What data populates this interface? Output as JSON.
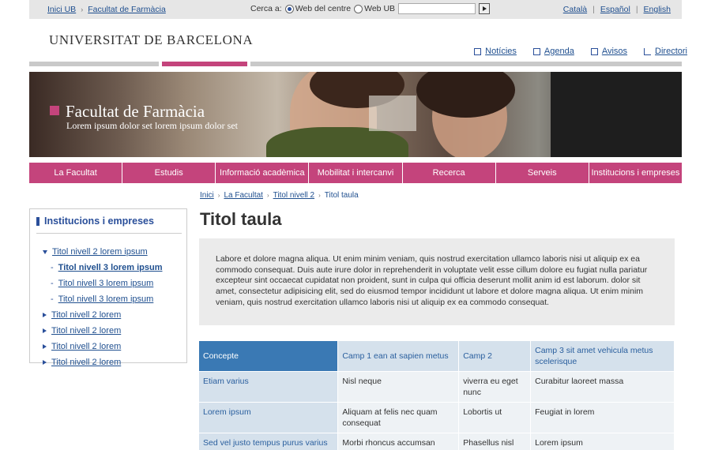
{
  "topbar": {
    "crumbs": [
      "Inici UB",
      "Facultat de Farmàcia"
    ],
    "search_label": "Cerca a:",
    "scope_options": [
      "Web del centre",
      "Web UB"
    ],
    "scope_selected": "Web del centre",
    "search_value": "",
    "languages": [
      "Català",
      "Español",
      "English"
    ]
  },
  "header": {
    "university": "UNIVERSITAT DE BARCELONA",
    "quicklinks": [
      {
        "label": "Notícies",
        "icon": "news-icon"
      },
      {
        "label": "Agenda",
        "icon": "calendar-icon"
      },
      {
        "label": "Avisos",
        "icon": "notice-icon"
      },
      {
        "label": "Directori",
        "icon": "directory-icon"
      }
    ]
  },
  "banner": {
    "title": "Facultat de Farmàcia",
    "subtitle": "Lorem ipsum dolor set lorem ipsum dolor set"
  },
  "mainnav": [
    "La Facultat",
    "Estudis",
    "Informació acadèmica",
    "Mobilitat i intercanvi",
    "Recerca",
    "Serveis",
    "Institucions i empreses"
  ],
  "breadcrumb": [
    "Inici",
    "La Facultat",
    "Titol nivell 2",
    "Titol taula"
  ],
  "sidebar": {
    "heading": "Institucions i empreses",
    "items": [
      {
        "label": "Titol nivell 2 lorem ipsum",
        "level": 2,
        "expanded": true
      },
      {
        "label": "Titol nivell 3 lorem ipsum",
        "level": 3,
        "active": true
      },
      {
        "label": "Titol nivell 3 lorem ipsum",
        "level": 3
      },
      {
        "label": "Titol nivell 3 lorem ipsum",
        "level": 3
      },
      {
        "label": "Titol nivell 2 lorem",
        "level": 2
      },
      {
        "label": "Titol nivell 2 lorem",
        "level": 2
      },
      {
        "label": "Titol nivell 2 lorem",
        "level": 2
      },
      {
        "label": "Titol nivell 2 lorem",
        "level": 2
      }
    ]
  },
  "content": {
    "title": "Titol taula",
    "intro": "Labore et dolore magna aliqua. Ut enim minim veniam, quis nostrud exercitation ullamco laboris nisi ut aliquip ex ea commodo consequat. Duis aute irure dolor in reprehenderit in voluptate velit esse cillum dolore eu fugiat nulla pariatur excepteur sint occaecat cupidatat non proident, sunt in culpa qui officia deserunt mollit anim id est laborum. dolor sit amet, consectetur adipisicing elit, sed do eiusmod tempor incididunt ut labore et dolore magna aliqua. Ut enim minim veniam, quis nostrud exercitation ullamco laboris nisi ut aliquip ex ea commodo consequat.",
    "table": {
      "headers": [
        "Concepte",
        "Camp 1 ean at sapien metus",
        "Camp 2",
        "Camp 3 sit amet vehicula metus scelerisque"
      ],
      "rows": [
        [
          "Etiam varius",
          "Nisl neque",
          "viverra eu eget nunc",
          "Curabitur laoreet massa"
        ],
        [
          "Lorem ipsum",
          "Aliquam at felis nec quam consequat",
          "Lobortis ut",
          "Feugiat in lorem"
        ],
        [
          "Sed vel justo tempus purus varius",
          "Morbi rhoncus accumsan",
          "Phasellus nisl",
          "Lorem ipsum"
        ]
      ]
    }
  },
  "colors": {
    "accent": "#c4447c",
    "link": "#1f4f8f",
    "table_header": "#3a79b4",
    "table_light": "#d5e1ec"
  }
}
